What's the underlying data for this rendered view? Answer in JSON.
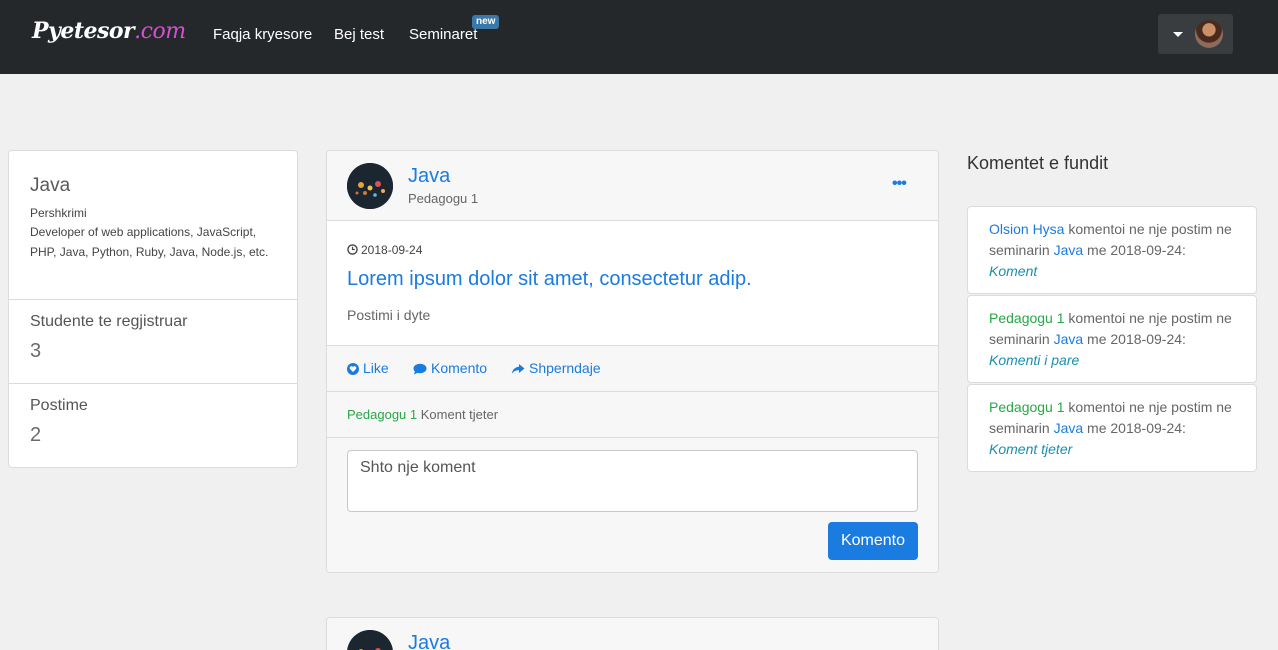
{
  "navbar": {
    "brand_part1": "Pyetesor",
    "brand_part2": ".com",
    "links": [
      {
        "label": "Faqja kryesore"
      },
      {
        "label": "Bej test"
      },
      {
        "label": "Seminaret"
      }
    ],
    "new_badge": "new"
  },
  "profile": {
    "title": "Java",
    "description_label": "Pershkrimi",
    "description": "Developer of web applications, JavaScript, PHP, Java, Python, Ruby, Java, Node.js, etc.",
    "students_label": "Studente te regjistruar",
    "students_count": "3",
    "posts_label": "Postime",
    "posts_count": "2"
  },
  "post": {
    "title": "Java",
    "author": "Pedagogu 1",
    "date": "2018-09-24",
    "headline": "Lorem ipsum dolor sit amet, consectetur adip.",
    "body": "Postimi i dyte",
    "actions": {
      "like": "Like",
      "comment": "Komento",
      "share": "Shperndaje"
    },
    "comment": {
      "author": "Pedagogu 1",
      "text": "Koment tjeter"
    },
    "comment_placeholder": "Shto nje koment",
    "comment_button": "Komento"
  },
  "post2": {
    "title": "Java"
  },
  "recent_comments": {
    "heading": "Komentet e fundit",
    "items": [
      {
        "user": "Olsion Hysa",
        "text1": " komentoi ne nje postim ne seminarin ",
        "seminar": "Java",
        "text2": " me 2018-09-24:",
        "comment": "Koment",
        "user_color": "blue"
      },
      {
        "user": "Pedagogu 1",
        "text1": " komentoi ne nje postim ne seminarin ",
        "seminar": "Java",
        "text2": " me 2018-09-24:",
        "comment": "Komenti i pare",
        "user_color": "green"
      },
      {
        "user": "Pedagogu 1",
        "text1": " komentoi ne nje postim ne seminarin ",
        "seminar": "Java",
        "text2": " me 2018-09-24:",
        "comment": "Koment tjeter",
        "user_color": "green"
      }
    ]
  },
  "colors": {
    "navbar": "#25282b",
    "accent": "#1a7be0",
    "green": "#28a745",
    "brand_accent": "#d54fd1"
  }
}
